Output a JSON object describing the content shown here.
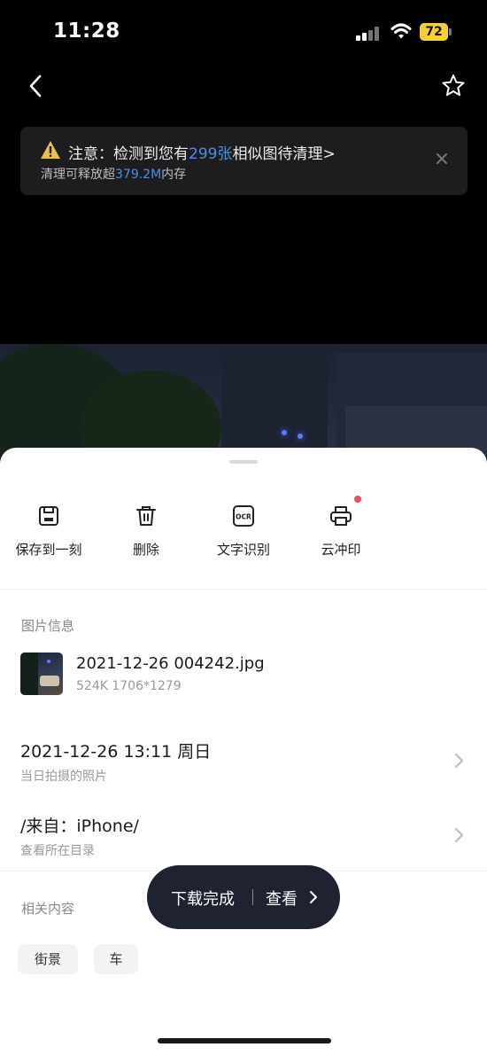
{
  "status_bar": {
    "time": "11:28",
    "battery": "72"
  },
  "notice": {
    "title_prefix": "注意：检测到您有",
    "count": "299张",
    "title_suffix": "相似图待清理>",
    "sub_prefix": "清理可释放超",
    "size": "379.2M",
    "sub_suffix": "内存"
  },
  "actions": [
    {
      "label": "保存到一刻",
      "icon": "save-icon"
    },
    {
      "label": "删除",
      "icon": "trash-icon"
    },
    {
      "label": "文字识别",
      "icon": "ocr-icon"
    },
    {
      "label": "云冲印",
      "icon": "printer-icon"
    }
  ],
  "info": {
    "title": "图片信息",
    "file_name": "2021-12-26 004242.jpg",
    "file_meta": "524K 1706*1279",
    "date_main": "2021-12-26 13:11 周日",
    "date_sub": "当日拍摄的照片",
    "source_main": "/来自：iPhone/",
    "source_sub": "查看所在目录"
  },
  "related": {
    "title": "相关内容",
    "tags": [
      "街景",
      "车"
    ]
  },
  "toast": {
    "status": "下载完成",
    "action": "查看"
  },
  "colors": {
    "accent": "#4a8fe8",
    "badge": "#f04b64",
    "toast_bg": "#1f2230"
  }
}
